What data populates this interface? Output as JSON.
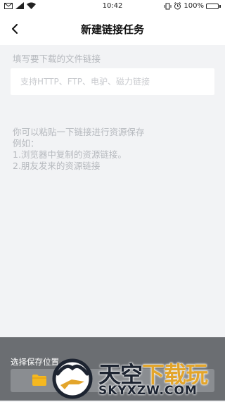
{
  "status_bar": {
    "time": "10:42",
    "battery_text": "100%",
    "battery_level": 1.0,
    "icons": [
      "mail-icon",
      "signal-icon",
      "wifi-icon",
      "vibrate-icon",
      "alarm-icon",
      "battery-icon"
    ]
  },
  "header": {
    "title": "新建链接任务",
    "back_icon": "chevron-left-icon"
  },
  "form": {
    "label": "填写要下载的文件链接",
    "link_input": {
      "value": "",
      "placeholder": "支持HTTP、FTP、电驴、磁力链接"
    }
  },
  "hint": {
    "lines": [
      "你可以粘贴一下链接进行资源保存",
      "例如：",
      "1.浏览器中复制的资源链接。",
      "2.朋友发来的资源链接"
    ]
  },
  "bottom": {
    "save_location_label": "选择保存位置",
    "folder_icon": "folder-icon"
  },
  "watermark": {
    "brand_cn_part1": "天空",
    "brand_cn_part2": "下载玩",
    "url": "SKYXZW.COM"
  },
  "colors": {
    "page_background": "#f2f3f5",
    "header_background": "#ffffff",
    "hint_text": "#b6b9be",
    "bottom_overlay": "#6b6e72",
    "folder_yellow": "#f5b820",
    "watermark_accent": "#e3a52b"
  }
}
